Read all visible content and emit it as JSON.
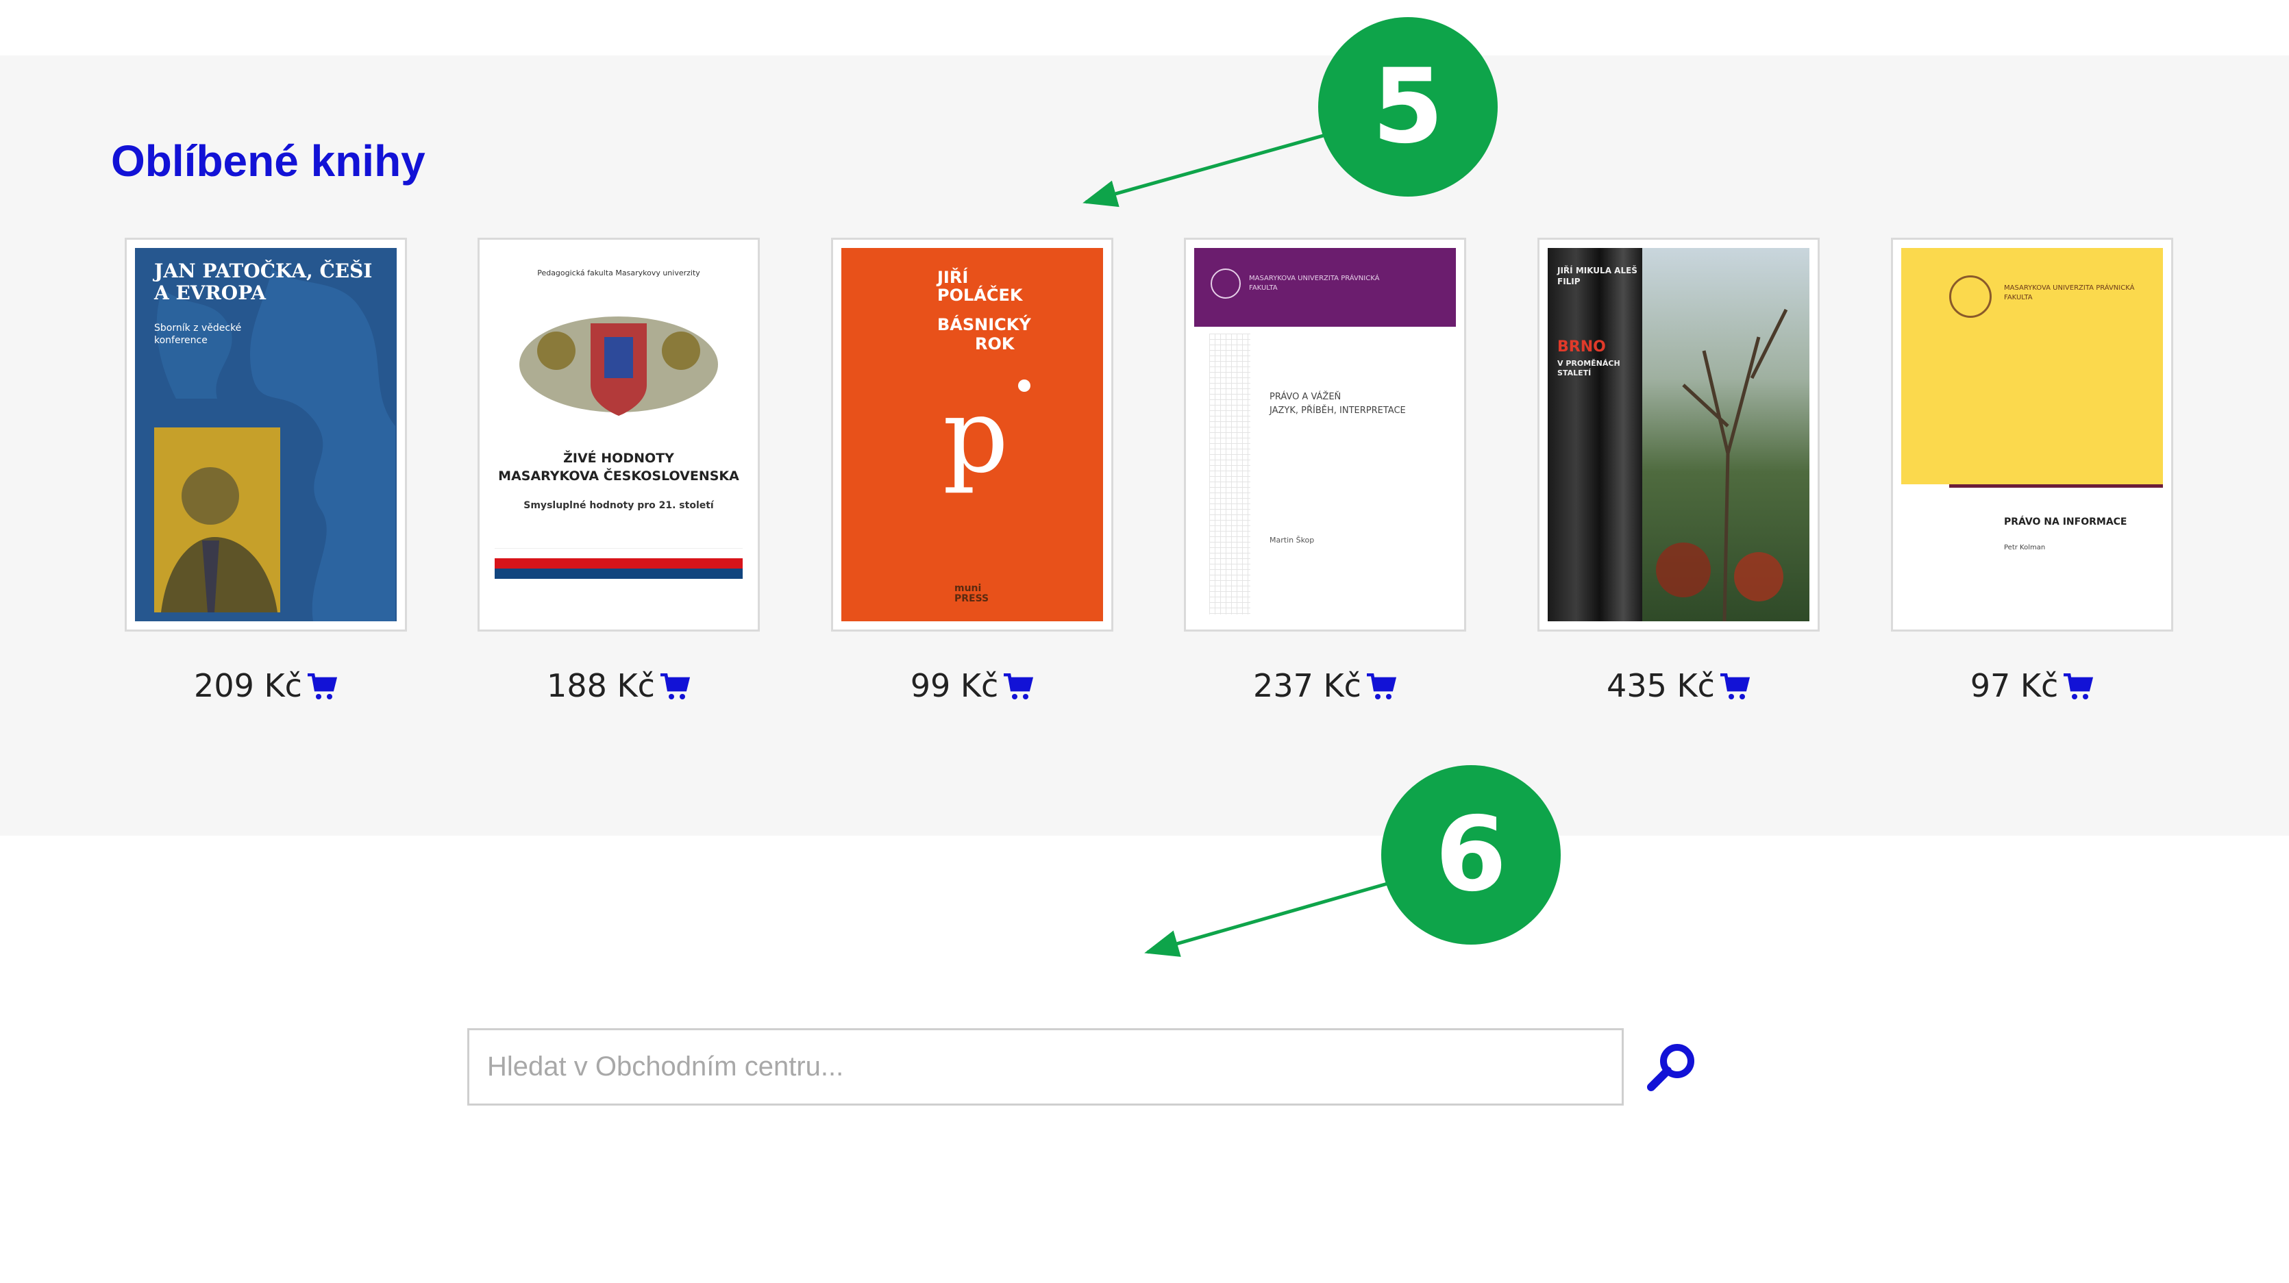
{
  "section": {
    "title": "Oblíbené knihy"
  },
  "books": [
    {
      "price": "209 Kč",
      "cover": {
        "title": "JAN PATOČKA, ČEŠI A EVROPA",
        "subtitle": "Sborník z vědecké konference"
      }
    },
    {
      "price": "188 Kč",
      "cover": {
        "publisher": "Pedagogická fakulta Masarykovy univerzity",
        "title_line1": "ŽIVÉ HODNOTY",
        "title_line2": "MASARYKOVA ČESKOSLOVENSKA",
        "subtitle": "Smysluplné hodnoty pro 21. století"
      }
    },
    {
      "price": "99 Kč",
      "cover": {
        "author": "JIŘÍ POLÁČEK",
        "title_line1": "BÁSNICKÝ",
        "title_line2": "ROK",
        "mark": "p",
        "publisher": "muni PRESS"
      }
    },
    {
      "price": "237 Kč",
      "cover": {
        "institution": "MASARYKOVA UNIVERZITA PRÁVNICKÁ FAKULTA",
        "title_line1": "PRÁVO A VÁŽEŇ",
        "title_line2": "JAZYK, PŘÍBĚH, INTERPRETACE",
        "author": "Martin Škop"
      }
    },
    {
      "price": "435 Kč",
      "cover": {
        "authors": "JIŘÍ MIKULA ALEŠ FILIP",
        "title": "BRNO",
        "subtitle": "V PROMĚNÁCH STALETÍ"
      }
    },
    {
      "price": "97 Kč",
      "cover": {
        "institution": "MASARYKOVA UNIVERZITA PRÁVNICKÁ FAKULTA",
        "title": "PRÁVO NA INFORMACE",
        "author": "Petr Kolman"
      }
    }
  ],
  "callouts": {
    "five": "5",
    "six": "6"
  },
  "search": {
    "placeholder": "Hledat v Obchodním centru..."
  },
  "colors": {
    "accent": "#1212d6",
    "callout": "#0ea44a"
  },
  "icons": {
    "cart": "cart-icon",
    "search": "search-icon"
  }
}
